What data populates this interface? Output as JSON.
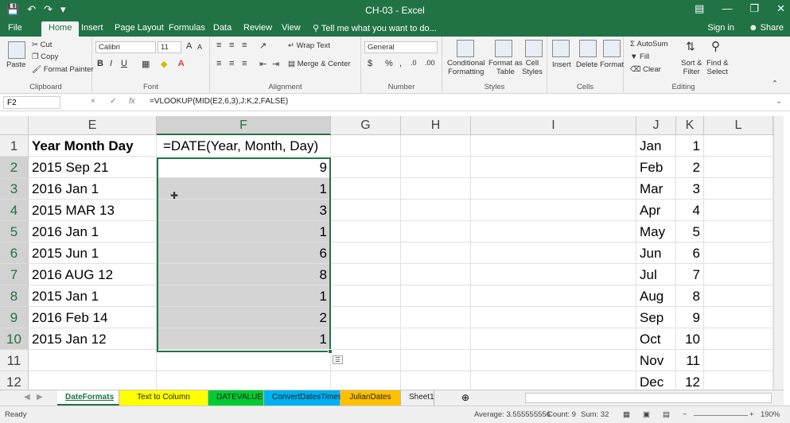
{
  "window": {
    "title": "CH-03 - Excel",
    "qat_icons": [
      "save-icon",
      "undo-icon",
      "redo-icon"
    ],
    "controls": [
      "ribbon-display-icon",
      "minimize-icon",
      "restore-icon",
      "close-icon"
    ]
  },
  "tabs": [
    "File",
    "Home",
    "Insert",
    "Page Layout",
    "Formulas",
    "Data",
    "Review",
    "View"
  ],
  "active_tab": "Home",
  "tell_me": "Tell me what you want to do...",
  "sign_in": "Sign in",
  "share": "Share",
  "ribbon": {
    "clipboard": {
      "label": "Clipboard",
      "paste": "Paste",
      "cut": "Cut",
      "copy": "Copy",
      "format_painter": "Format Painter"
    },
    "font": {
      "label": "Font",
      "name": "Calibri",
      "size": "11",
      "grow": "A",
      "shrink": "A",
      "bold": "B",
      "italic": "I",
      "underline": "U"
    },
    "alignment": {
      "label": "Alignment",
      "wrap": "Wrap Text",
      "merge": "Merge & Center"
    },
    "number": {
      "label": "Number",
      "format": "General",
      "currency": "$",
      "percent": "%",
      "comma": ",",
      "inc": ".0",
      "dec": ".00"
    },
    "styles": {
      "label": "Styles",
      "conditional_1": "Conditional",
      "conditional_2": "Formatting",
      "format_table_1": "Format as",
      "format_table_2": "Table",
      "cell_styles_1": "Cell",
      "cell_styles_2": "Styles"
    },
    "cells": {
      "label": "Cells",
      "insert": "Insert",
      "delete": "Delete",
      "format": "Format"
    },
    "editing": {
      "label": "Editing",
      "autosum": "AutoSum",
      "fill": "Fill",
      "clear": "Clear",
      "sort_1": "Sort &",
      "sort_2": "Filter",
      "find_1": "Find &",
      "find_2": "Select"
    }
  },
  "formula_bar": {
    "name_box": "F2",
    "cancel": "×",
    "enter": "✓",
    "fx": "fx",
    "formula": "=VLOOKUP(MID(E2,6,3),J:K,2,FALSE)"
  },
  "grid": {
    "columns": [
      "E",
      "F",
      "G",
      "H",
      "I",
      "J",
      "K",
      "L"
    ],
    "rows": [
      "1",
      "2",
      "3",
      "4",
      "5",
      "6",
      "7",
      "8",
      "9",
      "10",
      "11",
      "12"
    ],
    "e_col": [
      "Year Month Day",
      "2015 Sep 21",
      "2016 Jan 1",
      "2015 MAR 13",
      "2016 Jan 1",
      "2015 Jun 1",
      "2016 AUG 12",
      "2015 Jan 1",
      "2016 Feb 14",
      "2015 Jan 12",
      "",
      ""
    ],
    "f_col": [
      "=DATE(Year, Month, Day)",
      "9",
      "1",
      "3",
      "1",
      "6",
      "8",
      "1",
      "2",
      "1",
      "",
      ""
    ],
    "j_col": [
      "Jan",
      "Feb",
      "Mar",
      "Apr",
      "May",
      "Jun",
      "Jul",
      "Aug",
      "Sep",
      "Oct",
      "Nov",
      "Dec"
    ],
    "k_col": [
      "1",
      "2",
      "3",
      "4",
      "5",
      "6",
      "7",
      "8",
      "9",
      "10",
      "11",
      "12"
    ]
  },
  "sheets": [
    "DateFormats",
    "Text to Column Dates",
    "DATEVALUE",
    "ConvertDatesTimes",
    "JulianDates",
    "Sheet1"
  ],
  "sheet_colors": [
    "#ffffff",
    "#ffff00",
    "#00cc33",
    "#00b0f0",
    "#ffc000",
    "#f0f0f0"
  ],
  "active_sheet": "DateFormats",
  "status": {
    "ready": "Ready",
    "average": "Average: 3.555555556",
    "count": "Count: 9",
    "sum": "Sum: 32",
    "zoom": "190%"
  }
}
